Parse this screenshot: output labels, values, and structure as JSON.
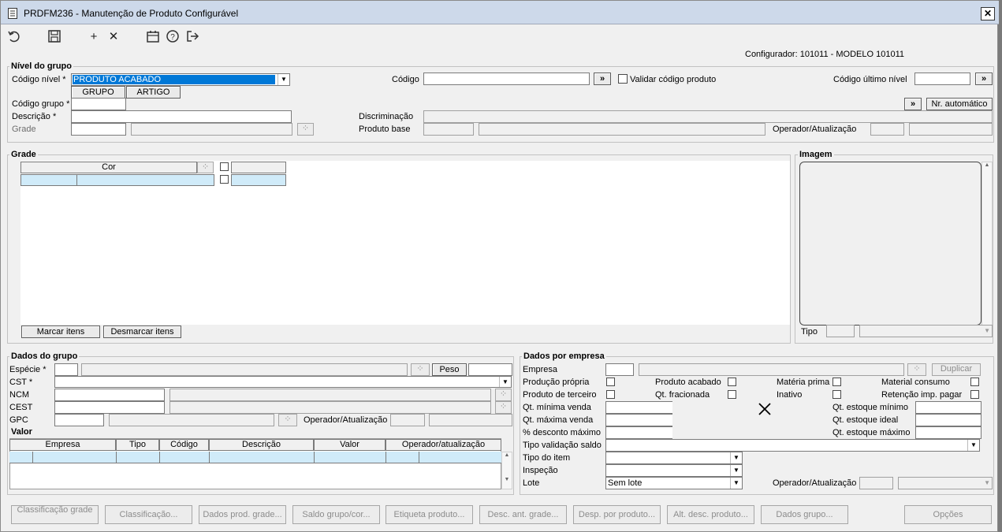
{
  "window": {
    "title": "PRDFM236 - Manutenção de Produto Configurável",
    "close_label": "✕"
  },
  "toolbar": {
    "icons": [
      "undo-icon",
      "save-icon",
      "add-icon",
      "delete-icon",
      "calendar-icon",
      "help-icon",
      "exit-icon"
    ]
  },
  "configurador": "Configurador: 101011 - MODELO 101011",
  "nivel": {
    "title": "Nível do grupo",
    "codigo_nivel_label": "Código nível *",
    "codigo_nivel_value": "PRODUTO ACABADO",
    "grupo_btn": "GRUPO",
    "artigo_btn": "ARTIGO",
    "codigo_label": "Código",
    "codigo_btn": "»",
    "validar_label": "Validar código produto",
    "ultimo_label": "Código último nível",
    "ultimo_btn": "»",
    "codigo_grupo_label": "Código grupo *",
    "descricao_label": "Descrição *",
    "grade_label": "Grade",
    "discriminacao_label": "Discriminação",
    "produto_base_label": "Produto base",
    "operador_label": "Operador/Atualização",
    "nr_btn_arrow": "»",
    "nr_automatico": "Nr. automático"
  },
  "grade": {
    "title": "Grade",
    "col_cor": "Cor",
    "marcar": "Marcar itens",
    "desmarcar": "Desmarcar itens"
  },
  "imagem": {
    "title": "Imagem",
    "tipo_label": "Tipo"
  },
  "dados_grupo": {
    "title": "Dados do grupo",
    "especie": "Espécie *",
    "peso": "Peso",
    "cst": "CST *",
    "ncm": "NCM",
    "cest": "CEST",
    "gpc": "GPC",
    "operador": "Operador/Atualização"
  },
  "valor": {
    "title": "Valor",
    "columns": [
      "Empresa",
      "Tipo",
      "Código",
      "Descrição",
      "Valor",
      "Operador/atualização"
    ]
  },
  "empresa": {
    "title": "Dados por empresa",
    "empresa": "Empresa",
    "duplicar": "Duplicar",
    "producao_propria": "Produção própria",
    "produto_acabado": "Produto acabado",
    "materia_prima": "Matéria prima",
    "material_consumo": "Material consumo",
    "produto_terceiro": "Produto de terceiro",
    "qt_fracionada": "Qt. fracionada",
    "inativo": "Inativo",
    "retencao": "Retenção imp. pagar",
    "qt_min_venda": "Qt. mínima venda",
    "qt_max_venda": "Qt. máxima venda",
    "desconto_max": "% desconto máximo",
    "qt_est_min": "Qt. estoque mínimo",
    "qt_est_ideal": "Qt. estoque ideal",
    "qt_est_max": "Qt. estoque máximo",
    "tipo_validacao": "Tipo validação saldo",
    "tipo_item": "Tipo do item",
    "inspecao": "Inspeção",
    "lote": "Lote",
    "lote_value": "Sem lote",
    "operador": "Operador/Atualização"
  },
  "bottom_buttons": {
    "b1": "Classificação grade",
    "b2": "Classificação...",
    "b3": "Dados prod. grade...",
    "b4": "Saldo grupo/cor...",
    "b5": "Etiqueta produto...",
    "b6": "Desc. ant. grade...",
    "b7": "Desp. por produto...",
    "b8": "Alt. desc. produto...",
    "b9": "Dados grupo...",
    "b10": "Opções"
  }
}
